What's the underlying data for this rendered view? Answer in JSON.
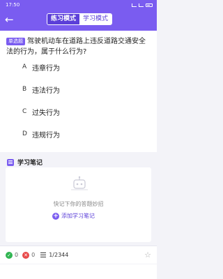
{
  "status_bar": {
    "time": "17:50"
  },
  "header": {
    "back_icon": "arrow-left-icon",
    "tabs": [
      {
        "label": "练习模式",
        "active": true
      },
      {
        "label": "学习模式",
        "active": false
      }
    ]
  },
  "question": {
    "type_badge": "单选题",
    "text": "驾驶机动车在道路上违反道路交通安全法的行为，属于什么行为?",
    "options": [
      {
        "letter": "A",
        "text": "违章行为"
      },
      {
        "letter": "B",
        "text": "违法行为"
      },
      {
        "letter": "C",
        "text": "过失行为"
      },
      {
        "letter": "D",
        "text": "违规行为"
      }
    ]
  },
  "notes": {
    "title": "学习笔记",
    "empty_hint": "快记下你的答题妙招",
    "add_label": "添加学习笔记"
  },
  "footer": {
    "correct_count": "0",
    "wrong_count": "0",
    "progress": "1/2344"
  },
  "colors": {
    "accent": "#7a5cf0",
    "correct": "#31b552",
    "wrong": "#e84a4a"
  }
}
